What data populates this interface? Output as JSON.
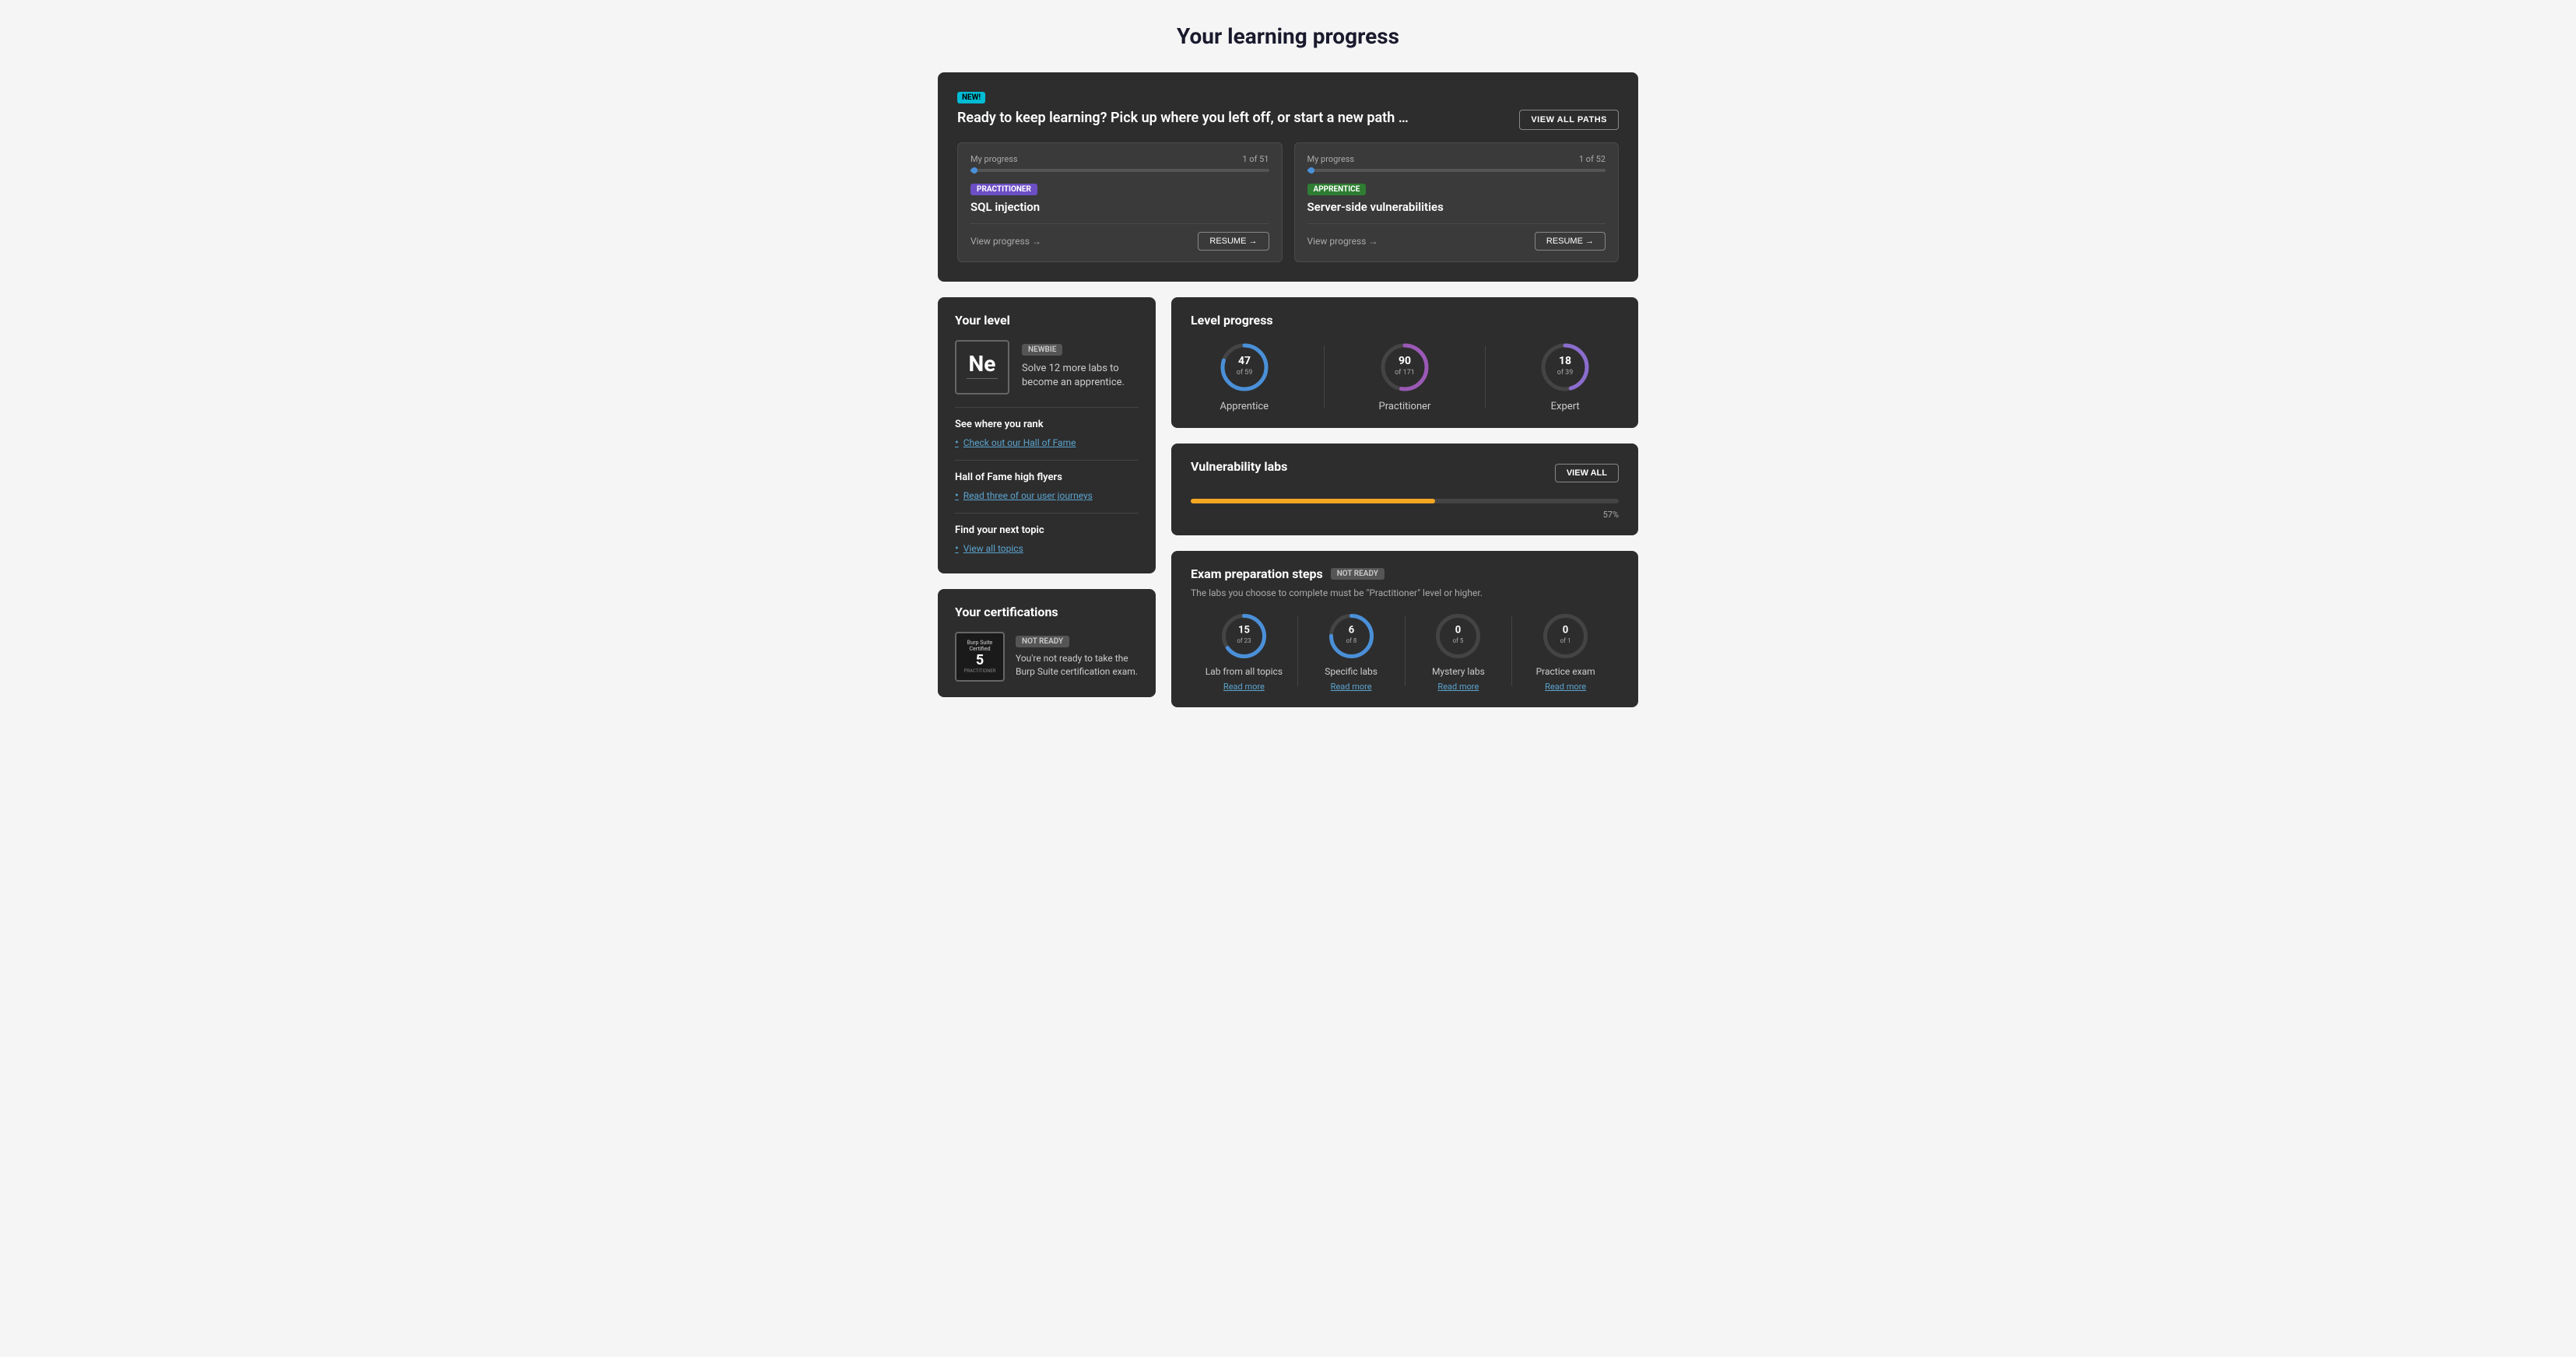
{
  "page": {
    "title": "Your learning progress"
  },
  "top_card": {
    "new_badge": "NEW!",
    "title": "Ready to keep learning? Pick up where you left off, or start a new path …",
    "view_all_paths_btn": "VIEW ALL PATHS",
    "cards": [
      {
        "label": "My progress",
        "count": "1 of 51",
        "fill_percent": 2,
        "level_badge": "PRACTITIONER",
        "level_type": "practitioner",
        "topic": "SQL injection",
        "view_progress": "View progress →",
        "resume_btn": "RESUME →"
      },
      {
        "label": "My progress",
        "count": "1 of 52",
        "fill_percent": 2,
        "level_badge": "APPRENTICE",
        "level_type": "apprentice",
        "topic": "Server-side vulnerabilities",
        "view_progress": "View progress →",
        "resume_btn": "RESUME →"
      }
    ]
  },
  "your_level": {
    "title": "Your level",
    "element_symbol": "Ne",
    "newbie_badge": "NEWBIE",
    "description": "Solve 12 more labs to become an apprentice.",
    "see_where_rank": "See where you rank",
    "hall_of_fame_link": "Check out our Hall of Fame",
    "high_flyers_title": "Hall of Fame high flyers",
    "user_journeys_link": "Read three of our user journeys",
    "find_topic_title": "Find your next topic",
    "view_all_topics_link": "View all topics"
  },
  "certifications": {
    "title": "Your certifications",
    "badge_title": "Burp Suite Certified",
    "badge_sub": "PRACTITIONER",
    "badge_number": "5",
    "not_ready_badge": "NOT READY",
    "description": "You're not ready to take the Burp Suite certification exam."
  },
  "level_progress": {
    "title": "Level progress",
    "levels": [
      {
        "label": "Apprentice",
        "current": 47,
        "total": 59,
        "color_main": "#4a90d9",
        "color_secondary": "#00e5ff"
      },
      {
        "label": "Practitioner",
        "current": 90,
        "total": 171,
        "color_main": "#9b59b6",
        "color_secondary": "#e91e63"
      },
      {
        "label": "Expert",
        "current": 18,
        "total": 39,
        "color_main": "#8b6dce",
        "color_secondary": "#4caf50"
      }
    ]
  },
  "vulnerability_labs": {
    "title": "Vulnerability labs",
    "view_all_btn": "VIEW ALL",
    "percent": 57,
    "percent_label": "57%"
  },
  "exam_prep": {
    "title": "Exam preparation steps",
    "not_ready_badge": "NOT READY",
    "subtitle": "The labs you choose to complete must be \"Practitioner\" level or higher.",
    "steps": [
      {
        "current": 15,
        "total": 23,
        "label": "Lab from all topics",
        "read_more": "Read more",
        "color": "#4a90d9"
      },
      {
        "current": 6,
        "total": 8,
        "label": "Specific labs",
        "read_more": "Read more",
        "color": "#4a90d9"
      },
      {
        "current": 0,
        "total": 5,
        "label": "Mystery labs",
        "read_more": "Read more",
        "color": "#4a90d9"
      },
      {
        "current": 0,
        "total": 1,
        "label": "Practice exam",
        "read_more": "Read more",
        "color": "#4a90d9"
      }
    ]
  }
}
